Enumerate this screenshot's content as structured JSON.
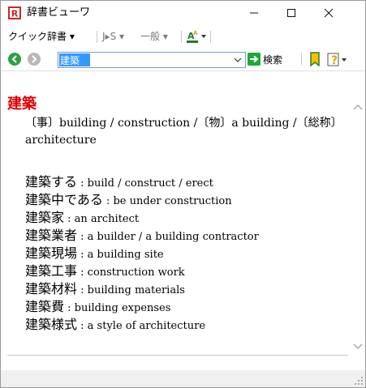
{
  "window": {
    "title": "辞書ビューワ",
    "icon": "dictionary-app-icon",
    "minimize_icon": "minimize-icon",
    "maximize_icon": "maximize-icon",
    "close_icon": "close-icon"
  },
  "toolbar": {
    "quick_dict_label": "クイック辞書 ▾",
    "dir_label": "J▸S ▾",
    "general_label": "一般 ▾",
    "font_icon": "font-color-icon"
  },
  "search": {
    "back_icon": "back-arrow-icon",
    "forward_icon": "forward-arrow-icon",
    "value": "建築",
    "search_label": "検索",
    "search_icon": "go-arrow-icon",
    "bookmark_icon": "bookmark-icon",
    "help_icon": "help-icon"
  },
  "entry": {
    "headword": "建築",
    "definition": "〔事〕building / construction /〔物〕a building /〔総称〕architecture",
    "compounds": [
      {
        "jp": "建築する",
        "en": " : build / construct / erect"
      },
      {
        "jp": "建築中である",
        "en": " : be under construction"
      },
      {
        "jp": "建築家",
        "en": " : an architect"
      },
      {
        "jp": "建築業者",
        "en": " : a builder / a building contractor"
      },
      {
        "jp": "建築現場",
        "en": " : a building site"
      },
      {
        "jp": "建築工事",
        "en": " : construction work"
      },
      {
        "jp": "建築材料",
        "en": " : building materials"
      },
      {
        "jp": "建築費",
        "en": " : building expenses"
      },
      {
        "jp": "建築様式",
        "en": " : a style of architecture"
      }
    ]
  },
  "colors": {
    "headword": "#e00000",
    "selection": "#3399ff",
    "nav_green": "#2ea043",
    "search_green": "#1fa83a"
  }
}
